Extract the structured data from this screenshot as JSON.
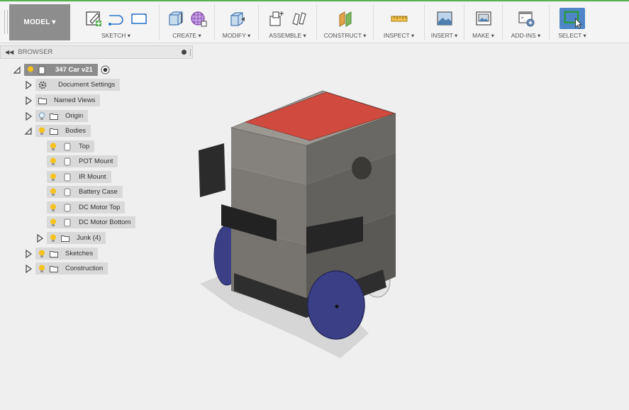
{
  "toolbar": {
    "workspace": "MODEL ▾",
    "groups": [
      {
        "label": "SKETCH ▾"
      },
      {
        "label": "CREATE ▾"
      },
      {
        "label": "MODIFY ▾"
      },
      {
        "label": "ASSEMBLE ▾"
      },
      {
        "label": "CONSTRUCT ▾"
      },
      {
        "label": "INSPECT ▾"
      },
      {
        "label": "INSERT ▾"
      },
      {
        "label": "MAKE ▾"
      },
      {
        "label": "ADD-INS ▾"
      },
      {
        "label": "SELECT ▾"
      }
    ],
    "accent": "#56b04e",
    "select_color": "#4e86c8"
  },
  "browser": {
    "title": "BROWSER",
    "root": "347 Car v21",
    "items": [
      {
        "label": "Document Settings"
      },
      {
        "label": "Named Views"
      },
      {
        "label": "Origin"
      },
      {
        "label": "Bodies"
      },
      {
        "label": "Top"
      },
      {
        "label": "POT Mount"
      },
      {
        "label": "IR Mount"
      },
      {
        "label": "Battery Case"
      },
      {
        "label": "DC Motor Top"
      },
      {
        "label": "DC Motor Bottom"
      },
      {
        "label": "Junk (4)"
      },
      {
        "label": "Sketches"
      },
      {
        "label": "Construction"
      }
    ]
  },
  "model_colors": {
    "top_plate": "#d04a3f",
    "body": "#6e6c68",
    "wheel": "#3b3f85"
  }
}
